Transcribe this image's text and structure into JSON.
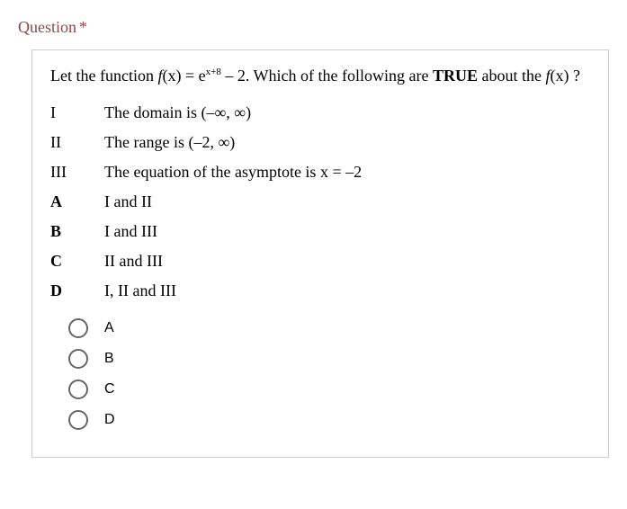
{
  "title": "Question",
  "asterisk": "*",
  "stem": {
    "prefix": "Let the function ",
    "func_left": "f",
    "func_arg": "(x) = e",
    "exponent": "x+8",
    "func_right": " – 2. Which of the following are ",
    "bold": "TRUE",
    "suffix": " about the ",
    "tail_fn": "f",
    "tail_arg": "(x) ?"
  },
  "statements": [
    {
      "label": "I",
      "text": "The domain is (–∞, ∞)"
    },
    {
      "label": "II",
      "text": "The range is (–2, ∞)"
    },
    {
      "label": "III",
      "text_prefix": "The equation of the asymptote is ",
      "eq_var": "x",
      "eq_rest": " = –2"
    }
  ],
  "answers": [
    {
      "label": "A",
      "text": "I and II"
    },
    {
      "label": "B",
      "text": "I and III"
    },
    {
      "label": "C",
      "text": "II and III"
    },
    {
      "label": "D",
      "text": "I, II and III"
    }
  ],
  "options": [
    {
      "label": "A"
    },
    {
      "label": "B"
    },
    {
      "label": "C"
    },
    {
      "label": "D"
    }
  ]
}
